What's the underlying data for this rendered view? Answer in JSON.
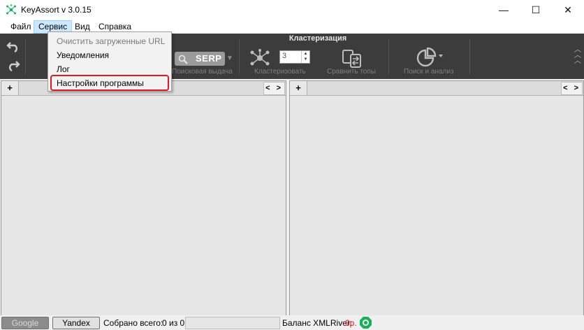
{
  "window": {
    "title": "KeyAssort v 3.0.15",
    "controls": {
      "minimize": "—",
      "maximize": "☐",
      "close": "✕"
    }
  },
  "menu": {
    "items": [
      "Файл",
      "Сервис",
      "Вид",
      "Справка"
    ],
    "active": "Сервис"
  },
  "dropdown": {
    "items": [
      "Очистить загруженные URL",
      "Уведомления",
      "Лог",
      "Настройки программы"
    ],
    "highlighted": "Настройки программы",
    "disabled": "Очистить загруженные URL"
  },
  "toolbar": {
    "group_title": "Кластеризация",
    "serp_label": "SERP",
    "labels": {
      "search_results": "Поисковая выдача",
      "clusterize": "Кластеризовать",
      "compare_tops": "Сравнить топы",
      "search_analysis": "Поиск и анализ"
    },
    "cluster_value": "3",
    "icons": [
      "undo-icon",
      "redo-icon",
      "search-icon",
      "cluster-icon",
      "compare-icon",
      "pie-chart-icon",
      "collapse-icon"
    ]
  },
  "panels": {
    "left": {
      "add": "+",
      "nav": "< >"
    },
    "right": {
      "add": "+",
      "nav": "< >"
    }
  },
  "status": {
    "google": "Google",
    "yandex": "Yandex",
    "collected_label": "Собрано всего:",
    "collected_value": "0 из 0",
    "balance_label": "Баланс XMLRiver:",
    "balance_value": "0р.",
    "accent_red": "#e0181f",
    "badge_color": "#18b058"
  }
}
